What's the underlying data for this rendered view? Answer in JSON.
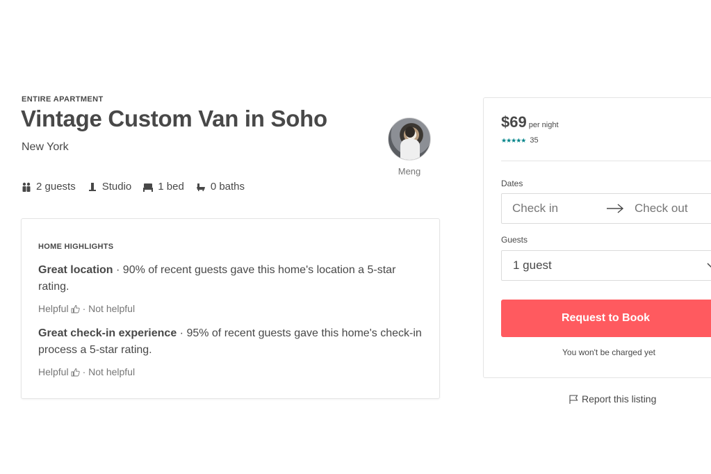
{
  "listing": {
    "type_label": "ENTIRE APARTMENT",
    "title": "Vintage Custom Van in Soho",
    "location": "New York",
    "host_name": "Meng"
  },
  "amenities": [
    {
      "icon": "guests-icon",
      "label": "2 guests"
    },
    {
      "icon": "studio-icon",
      "label": "Studio"
    },
    {
      "icon": "bed-icon",
      "label": "1 bed"
    },
    {
      "icon": "bath-icon",
      "label": "0 baths"
    }
  ],
  "highlights": {
    "title": "HOME HIGHLIGHTS",
    "items": [
      {
        "heading": "Great location",
        "text": " · 90% of recent guests gave this home's location a 5-star rating.",
        "helpful": "Helpful",
        "not_helpful": "· Not helpful"
      },
      {
        "heading": "Great check-in experience",
        "text": " · 95% of recent guests gave this home's check-in process a 5-star rating.",
        "helpful": "Helpful",
        "not_helpful": "· Not helpful"
      }
    ]
  },
  "booking": {
    "price": "$69",
    "per_night": "per night",
    "stars": "★★★★★",
    "review_count": "35",
    "dates_label": "Dates",
    "check_in_placeholder": "Check in",
    "check_out_placeholder": "Check out",
    "guests_label": "Guests",
    "guests_value": "1 guest",
    "book_button": "Request to Book",
    "note": "You won't be charged yet"
  },
  "report_link": "Report this listing",
  "colors": {
    "accent": "#ff5a5f",
    "stars": "#008489",
    "text": "#484848",
    "muted": "#767676",
    "border": "#e4e4e4"
  }
}
